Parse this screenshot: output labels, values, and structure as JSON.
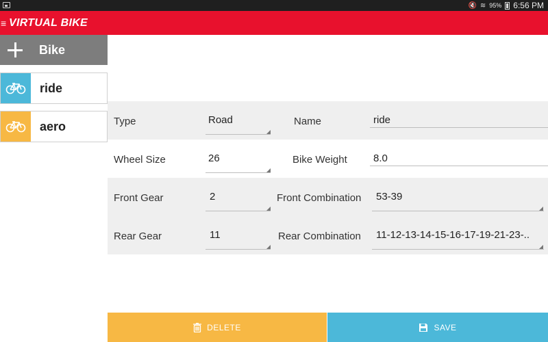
{
  "status_bar": {
    "battery": "95%",
    "time": "6:56 PM"
  },
  "app_bar": {
    "title": "VIRTUAL BIKE",
    "menu_icon": "hamburger-icon"
  },
  "sidebar": {
    "add_label": "Bike",
    "items": [
      {
        "name": "ride",
        "icon": "bicycle-icon",
        "color": "#4cb8d9"
      },
      {
        "name": "aero",
        "icon": "bicycle-icon",
        "color": "#f7b844"
      }
    ]
  },
  "form": {
    "type": {
      "label": "Type",
      "value": "Road"
    },
    "name": {
      "label": "Name",
      "value": "ride"
    },
    "wheel_size": {
      "label": "Wheel Size",
      "value": "26"
    },
    "bike_weight": {
      "label": "Bike Weight",
      "value": "8.0"
    },
    "front_gear": {
      "label": "Front Gear",
      "value": "2"
    },
    "front_combination": {
      "label": "Front Combination",
      "value": "53-39"
    },
    "rear_gear": {
      "label": "Rear Gear",
      "value": "11"
    },
    "rear_combination": {
      "label": "Rear Combination",
      "value": "11-12-13-14-15-16-17-19-21-23-.."
    }
  },
  "actions": {
    "delete_label": "DELETE",
    "save_label": "SAVE"
  },
  "colors": {
    "accent": "#e8112d",
    "delete": "#f7b844",
    "save": "#4cb8d9",
    "sidebar_add": "#7d7d7d"
  }
}
